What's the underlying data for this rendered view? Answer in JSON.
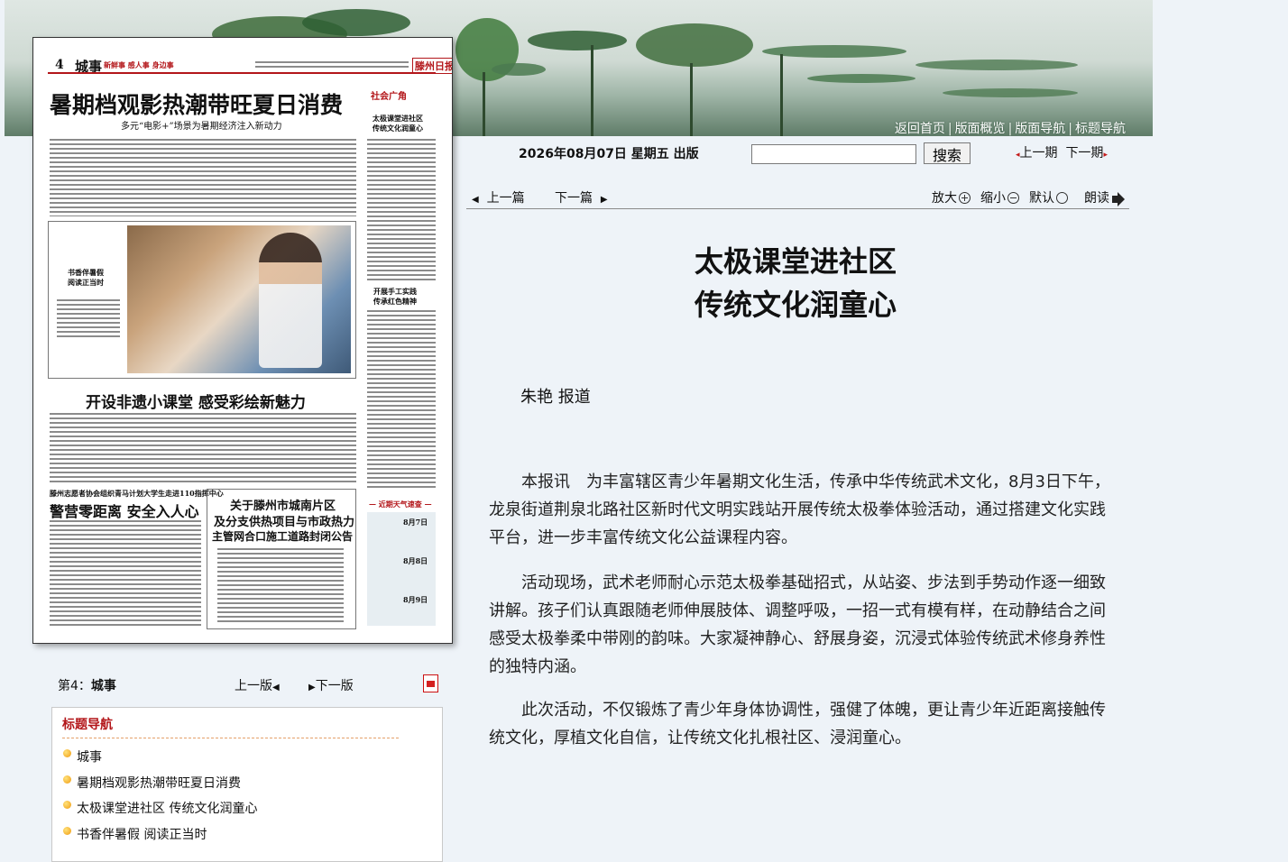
{
  "banner": {
    "links": [
      "返回首页",
      "版面概览",
      "版面导航",
      "标题导航"
    ]
  },
  "newspaper_page": {
    "page_no": "4",
    "section": "城事",
    "slogan": "新鲜事 感人事 身边事",
    "headline": "暑期档观影热潮带旺夏日消费",
    "subheadline": "多元“电影+”场景为暑期经济注入新动力",
    "column_label": "社会广角",
    "side_title_1": "太极课堂进社区",
    "side_title_2": "传统文化润童心",
    "photo_caption_1": "书香伴暑假",
    "photo_caption_2": "阅读正当时",
    "side_title_3": "开展手工实践",
    "side_title_4": "传承红色精神",
    "headline_2": "开设非遗小课堂 感受彩绘新魅力",
    "kicker_3": "滕州志愿者协会组织青马计划大学生走进110指挥中心",
    "headline_3": "警营零距离 安全入人心",
    "notice_title_1": "关于滕州市城南片区",
    "notice_title_2": "及分支供热项目与市政热力",
    "notice_title_3": "主管网合口施工道路封闭公告",
    "weather_title": "— 近期天气速查 —",
    "weather": [
      {
        "date": "8月7日"
      },
      {
        "date": "8月8日"
      },
      {
        "date": "8月9日"
      }
    ]
  },
  "header": {
    "issue_date": "2026年08月07日 星期五 出版",
    "search_placeholder": "",
    "search_button": "搜索",
    "prev_issue": "上一期",
    "next_issue": "下一期"
  },
  "toolbar": {
    "prev_article": "上一篇",
    "next_article": "下一篇",
    "zoom_in": "放大",
    "zoom_out": "缩小",
    "default": "默认",
    "read_aloud": "朗读"
  },
  "article": {
    "title_line1": "太极课堂进社区",
    "title_line2": "传统文化润童心",
    "byline": "朱艳 报道",
    "paragraphs": [
      "本报讯　为丰富辖区青少年暑期文化生活，传承中华传统武术文化，8月3日下午，龙泉街道荆泉北路社区新时代文明实践站开展传统太极拳体验活动，通过搭建文化实践平台，进一步丰富传统文化公益课程内容。",
      "活动现场，武术老师耐心示范太极拳基础招式，从站姿、步法到手势动作逐一细致讲解。孩子们认真跟随老师伸展肢体、调整呼吸，一招一式有模有样，在动静结合之间感受太极拳柔中带刚的韵味。大家凝神静心、舒展身姿，沉浸式体验传统武术修身养性的独特内涵。",
      "此次活动，不仅锻炼了青少年身体协调性，强健了体魄，更让青少年近距离接触传统文化，厚植文化自信，让传统文化扎根社区、浸润童心。"
    ]
  },
  "page_nav": {
    "page_prefix": "第4：",
    "page_name": "城事",
    "prev_page": "上一版",
    "next_page": "下一版"
  },
  "title_nav": {
    "heading": "标题导航",
    "items": [
      "城事",
      "暑期档观影热潮带旺夏日消费",
      "太极课堂进社区 传统文化润童心",
      "书香伴暑假 阅读正当时"
    ]
  }
}
